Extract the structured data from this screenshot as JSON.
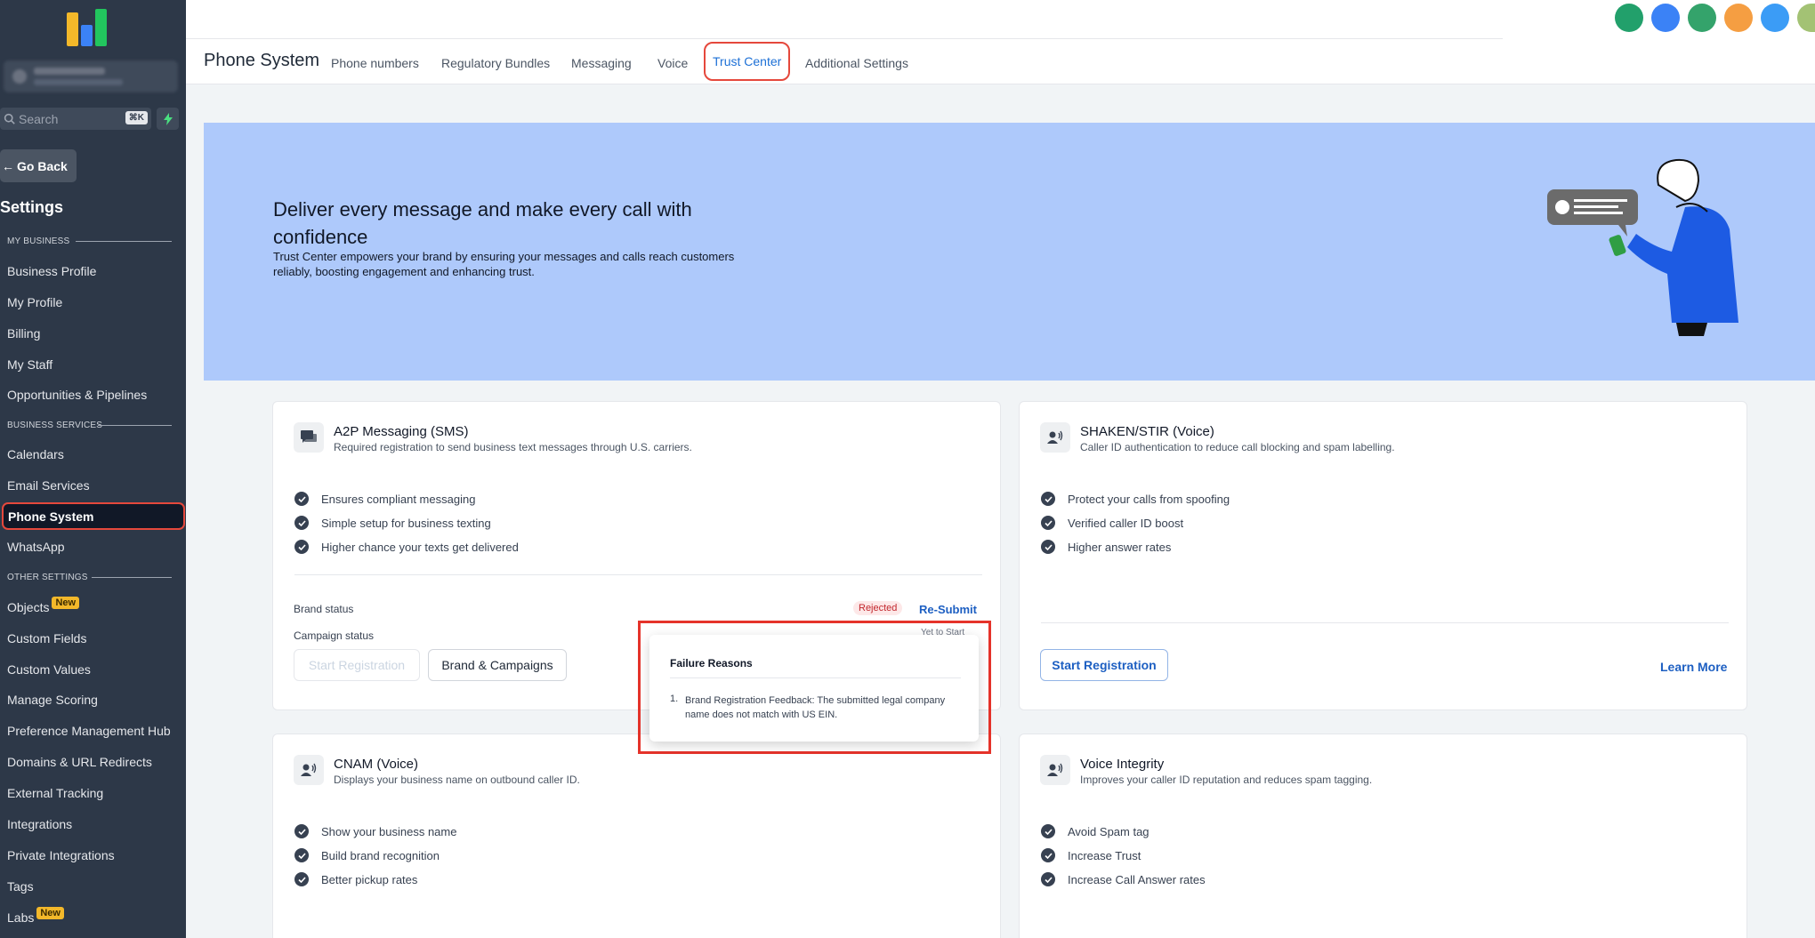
{
  "sidebar": {
    "search_placeholder": "Search",
    "search_shortcut": "⌘K",
    "go_back": "Go Back",
    "title": "Settings",
    "sections": {
      "my_business": "MY BUSINESS",
      "business_services": "BUSINESS SERVICES",
      "other_settings": "OTHER SETTINGS"
    },
    "items": {
      "business_profile": "Business Profile",
      "my_profile": "My Profile",
      "billing": "Billing",
      "my_staff": "My Staff",
      "opportunities": "Opportunities & Pipelines",
      "calendars": "Calendars",
      "email_services": "Email Services",
      "phone_system": "Phone System",
      "whatsapp": "WhatsApp",
      "objects": "Objects",
      "custom_fields": "Custom Fields",
      "custom_values": "Custom Values",
      "manage_scoring": "Manage Scoring",
      "preference_hub": "Preference Management Hub",
      "domains": "Domains & URL Redirects",
      "external_tracking": "External Tracking",
      "integrations": "Integrations",
      "private_integrations": "Private Integrations",
      "tags": "Tags",
      "labs": "Labs"
    },
    "new_badge": "New"
  },
  "header": {
    "title": "Phone System",
    "tabs": {
      "phone_numbers": "Phone numbers",
      "regulatory_bundles": "Regulatory Bundles",
      "messaging": "Messaging",
      "voice": "Voice",
      "trust_center": "Trust Center",
      "additional_settings": "Additional Settings"
    }
  },
  "banner": {
    "heading": "Deliver every message and make every call with confidence",
    "description": "Trust Center empowers your brand by ensuring your messages and calls reach customers reliably, boosting engagement and enhancing trust."
  },
  "cards": {
    "a2p": {
      "title": "A2P Messaging (SMS)",
      "subtitle": "Required registration to send business text messages through U.S. carriers.",
      "features": [
        "Ensures compliant messaging",
        "Simple setup for business texting",
        "Higher chance your texts get delivered"
      ],
      "brand_status_label": "Brand status",
      "brand_status_value": "Rejected",
      "resubmit": "Re-Submit",
      "campaign_status_label": "Campaign status",
      "campaign_status_value": "Yet to Start",
      "start_registration": "Start Registration",
      "brand_campaigns": "Brand & Campaigns"
    },
    "shaken": {
      "title": "SHAKEN/STIR (Voice)",
      "subtitle": "Caller ID authentication to reduce call blocking and spam labelling.",
      "features": [
        "Protect your calls from spoofing",
        "Verified caller ID boost",
        "Higher answer rates"
      ],
      "start_registration": "Start Registration",
      "learn_more": "Learn More"
    },
    "cnam": {
      "title": "CNAM (Voice)",
      "subtitle": "Displays your business name on outbound caller ID.",
      "features": [
        "Show your business name",
        "Build brand recognition",
        "Better pickup rates"
      ]
    },
    "voice_integrity": {
      "title": "Voice Integrity",
      "subtitle": "Improves your caller ID reputation and reduces spam tagging.",
      "features": [
        "Avoid Spam tag",
        "Increase Trust",
        "Increase Call Answer rates"
      ]
    }
  },
  "popover": {
    "title": "Failure Reasons",
    "number": "1.",
    "reason": "Brand Registration Feedback: The submitted legal company name does not match with US EIN."
  },
  "colors": {
    "sidebar_bg": "#2d3848",
    "accent": "#1d70d6",
    "highlight": "#e5483c",
    "banner_bg": "#aec9fb"
  }
}
